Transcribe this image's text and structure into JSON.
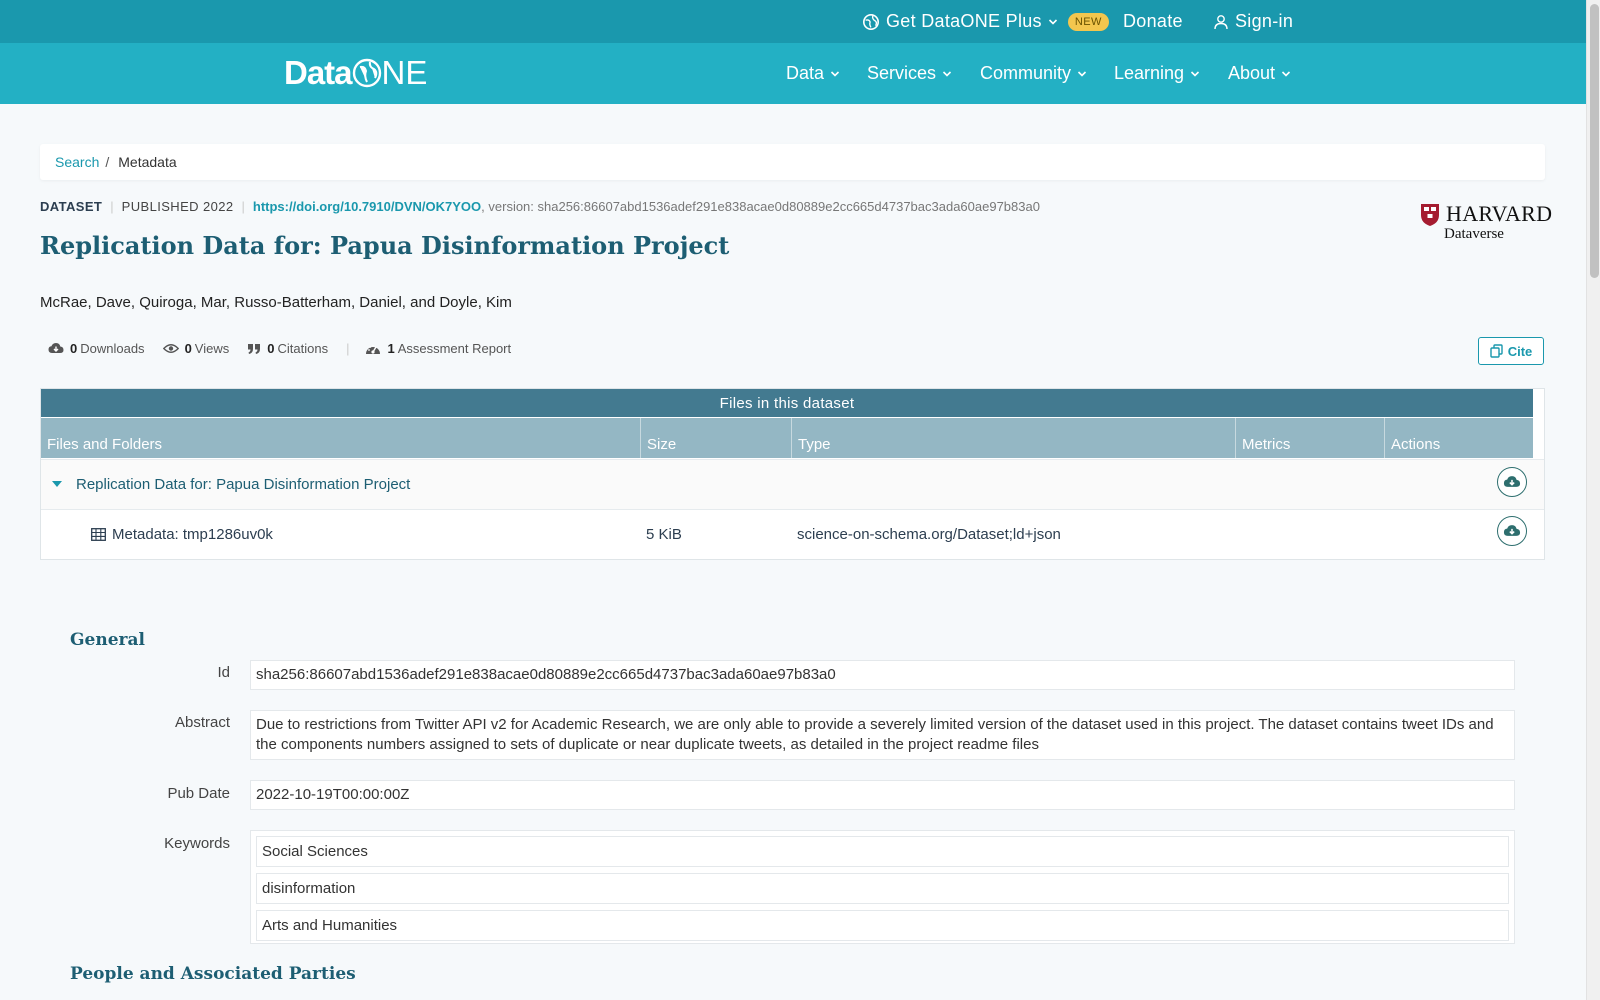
{
  "topbar": {
    "plus_label": "Get DataONE Plus",
    "new_badge": "NEW",
    "donate": "Donate",
    "signin": "Sign-in"
  },
  "logo": {
    "data": "Data",
    "one_o": "O",
    "one_rest": "NE"
  },
  "nav": [
    {
      "label": "Data"
    },
    {
      "label": "Services"
    },
    {
      "label": "Community"
    },
    {
      "label": "Learning"
    },
    {
      "label": "About"
    }
  ],
  "breadcrumb": {
    "search": "Search",
    "separator": "/",
    "current": "Metadata"
  },
  "dataset": {
    "type": "DATASET",
    "published": "PUBLISHED 2022",
    "doi": "https://doi.org/10.7910/DVN/OK7YOO",
    "version": ", version: sha256:86607abd1536adef291e838acae0d80889e2cc665d4737bac3ada60ae97b83a0",
    "title": "Replication Data for: Papua Disinformation Project",
    "authors": "McRae, Dave, Quiroga, Mar, Russo-Batterham, Daniel, and Doyle, Kim",
    "repository": {
      "name": "HARVARD",
      "sub": "Dataverse"
    }
  },
  "metrics": {
    "downloads_count": "0",
    "downloads_label": "Downloads",
    "views_count": "0",
    "views_label": "Views",
    "citations_count": "0",
    "citations_label": "Citations",
    "assessment_count": "1",
    "assessment_label": "Assessment Report"
  },
  "cite_label": "Cite",
  "files": {
    "caption": "Files in this dataset",
    "columns": [
      "Files and Folders",
      "Size",
      "Type",
      "Metrics",
      "Actions"
    ],
    "folder": {
      "name": "Replication Data for: Papua Disinformation Project"
    },
    "file": {
      "name": "Metadata: tmp1286uv0k",
      "size": "5 KiB",
      "type": "science-on-schema.org/Dataset;ld+json"
    }
  },
  "general": {
    "title": "General",
    "id_label": "Id",
    "id_value": "sha256:86607abd1536adef291e838acae0d80889e2cc665d4737bac3ada60ae97b83a0",
    "abstract_label": "Abstract",
    "abstract_value": "Due to restrictions from Twitter API v2 for Academic Research, we are only able to provide a severely limited version of the dataset used in this project. The dataset contains tweet IDs and the components numbers assigned to sets of duplicate or near duplicate tweets, as detailed in the project readme files",
    "pubdate_label": "Pub Date",
    "pubdate_value": "2022-10-19T00:00:00Z",
    "keywords_label": "Keywords",
    "keywords": [
      "Social Sciences",
      "disinformation",
      "Arts and Humanities"
    ]
  },
  "people": {
    "title": "People and Associated Parties"
  },
  "colors": {
    "topbar": "#1a98ad",
    "navbar": "#23b0c4",
    "table_caption": "#437a90",
    "table_head": "#94b7c4",
    "accent": "#1a98ad"
  }
}
